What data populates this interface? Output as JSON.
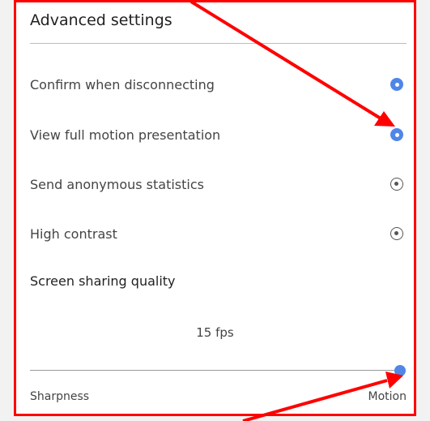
{
  "panel": {
    "title": "Advanced settings"
  },
  "options": [
    {
      "label": "Confirm when disconnecting",
      "selected": true
    },
    {
      "label": "View full motion presentation",
      "selected": true
    },
    {
      "label": "Send anonymous statistics",
      "selected": false
    },
    {
      "label": "High contrast",
      "selected": false
    }
  ],
  "quality": {
    "section_label": "Screen sharing quality",
    "value_text": "15 fps",
    "slider_fraction": 1.0,
    "min_label": "Sharpness",
    "max_label": "Motion"
  },
  "colors": {
    "accent": "#4f86e8",
    "annotation": "#ff0000"
  }
}
